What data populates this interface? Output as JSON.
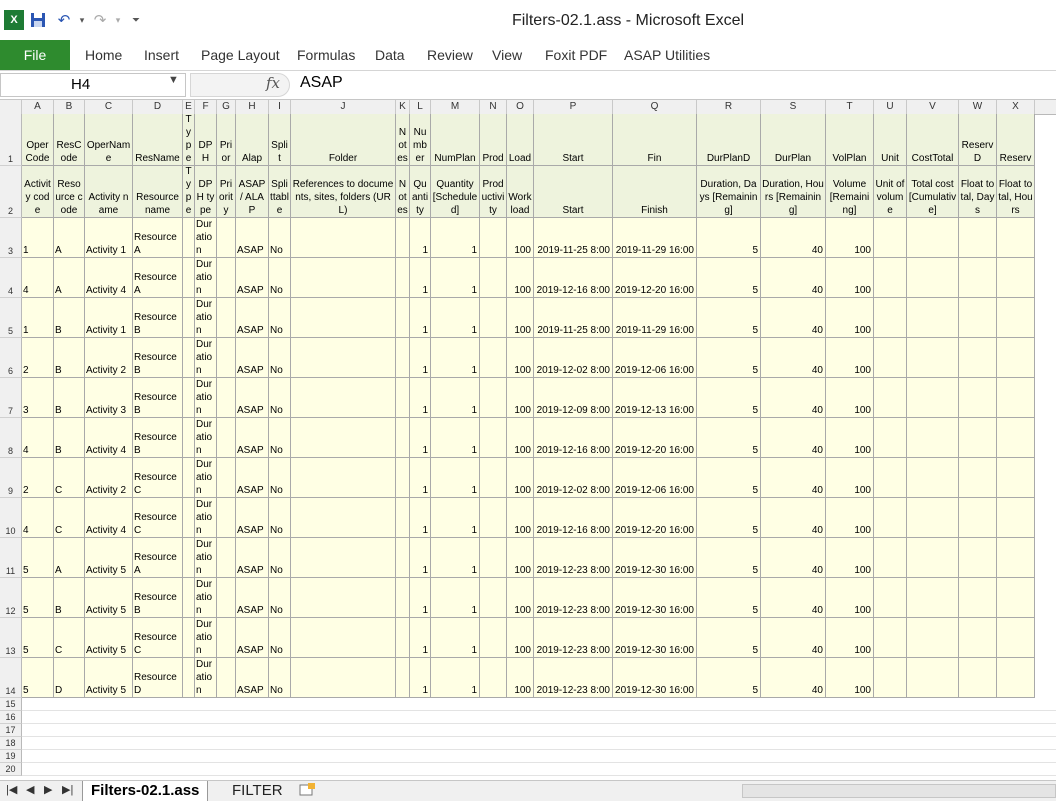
{
  "window": {
    "title": "Filters-02.1.ass  -  Microsoft Excel"
  },
  "ribbon": {
    "file": "File",
    "tabs": [
      "Home",
      "Insert",
      "Page Layout",
      "Formulas",
      "Data",
      "Review",
      "View",
      "Foxit PDF",
      "ASAP Utilities"
    ]
  },
  "formula_bar": {
    "name_box": "H4",
    "fx_label": "fx",
    "value": "ASAP"
  },
  "columns": [
    "A",
    "B",
    "C",
    "D",
    "E",
    "F",
    "G",
    "H",
    "I",
    "J",
    "K",
    "L",
    "M",
    "N",
    "O",
    "P",
    "Q",
    "R",
    "S",
    "T",
    "U",
    "V",
    "W",
    "X"
  ],
  "header_row1": [
    "Oper Code",
    "ResCode",
    "OperName",
    "ResName",
    "Type",
    "DPH",
    "Prior",
    "Alap",
    "Split",
    "Folder",
    "Notes",
    "Number",
    "NumPlan",
    "Prod",
    "Load",
    "Start",
    "Fin",
    "DurPlanD",
    "DurPlan",
    "VolPlan",
    "Unit",
    "CostTotal",
    "ReservD",
    "Reserv"
  ],
  "header_row2": [
    "Activity code",
    "Resource code",
    "Activity name",
    "Resource name",
    "Type",
    "DPH type",
    "Priority",
    "ASAP / ALAP",
    "Splittable",
    "References to documents, sites, folders (URL)",
    "Notes",
    "Quantity",
    "Quantity [Scheduled]",
    "Productivity",
    "Workload",
    "Start",
    "Finish",
    "Duration, Days [Remaining]",
    "Duration, Hours [Remaining]",
    "Volume [Remaining]",
    "Unit of volume",
    "Total cost [Cumulative]",
    "Float total, Days",
    "Float total, Hours"
  ],
  "rows": [
    {
      "n": "3",
      "a": "1",
      "b": "A",
      "c": "Activity 1",
      "d": "Resource A",
      "f": "Duration",
      "h": "ASAP",
      "i": "No",
      "l": "1",
      "m": "1",
      "o": "100",
      "p": "2019-11-25 8:00",
      "q": "2019-11-29 16:00",
      "r": "5",
      "s": "40",
      "t": "100"
    },
    {
      "n": "4",
      "a": "4",
      "b": "A",
      "c": "Activity 4",
      "d": "Resource A",
      "f": "Duration",
      "h": "ASAP",
      "i": "No",
      "l": "1",
      "m": "1",
      "o": "100",
      "p": "2019-12-16 8:00",
      "q": "2019-12-20 16:00",
      "r": "5",
      "s": "40",
      "t": "100"
    },
    {
      "n": "5",
      "a": "1",
      "b": "B",
      "c": "Activity 1",
      "d": "Resource B",
      "f": "Duration",
      "h": "ASAP",
      "i": "No",
      "l": "1",
      "m": "1",
      "o": "100",
      "p": "2019-11-25 8:00",
      "q": "2019-11-29 16:00",
      "r": "5",
      "s": "40",
      "t": "100"
    },
    {
      "n": "6",
      "a": "2",
      "b": "B",
      "c": "Activity 2",
      "d": "Resource B",
      "f": "Duration",
      "h": "ASAP",
      "i": "No",
      "l": "1",
      "m": "1",
      "o": "100",
      "p": "2019-12-02 8:00",
      "q": "2019-12-06 16:00",
      "r": "5",
      "s": "40",
      "t": "100"
    },
    {
      "n": "7",
      "a": "3",
      "b": "B",
      "c": "Activity 3",
      "d": "Resource B",
      "f": "Duration",
      "h": "ASAP",
      "i": "No",
      "l": "1",
      "m": "1",
      "o": "100",
      "p": "2019-12-09 8:00",
      "q": "2019-12-13 16:00",
      "r": "5",
      "s": "40",
      "t": "100"
    },
    {
      "n": "8",
      "a": "4",
      "b": "B",
      "c": "Activity 4",
      "d": "Resource B",
      "f": "Duration",
      "h": "ASAP",
      "i": "No",
      "l": "1",
      "m": "1",
      "o": "100",
      "p": "2019-12-16 8:00",
      "q": "2019-12-20 16:00",
      "r": "5",
      "s": "40",
      "t": "100"
    },
    {
      "n": "9",
      "a": "2",
      "b": "C",
      "c": "Activity 2",
      "d": "Resource C",
      "f": "Duration",
      "h": "ASAP",
      "i": "No",
      "l": "1",
      "m": "1",
      "o": "100",
      "p": "2019-12-02 8:00",
      "q": "2019-12-06 16:00",
      "r": "5",
      "s": "40",
      "t": "100"
    },
    {
      "n": "10",
      "a": "4",
      "b": "C",
      "c": "Activity 4",
      "d": "Resource C",
      "f": "Duration",
      "h": "ASAP",
      "i": "No",
      "l": "1",
      "m": "1",
      "o": "100",
      "p": "2019-12-16 8:00",
      "q": "2019-12-20 16:00",
      "r": "5",
      "s": "40",
      "t": "100"
    },
    {
      "n": "11",
      "a": "5",
      "b": "A",
      "c": "Activity 5",
      "d": "Resource A",
      "f": "Duration",
      "h": "ASAP",
      "i": "No",
      "l": "1",
      "m": "1",
      "o": "100",
      "p": "2019-12-23 8:00",
      "q": "2019-12-30 16:00",
      "r": "5",
      "s": "40",
      "t": "100"
    },
    {
      "n": "12",
      "a": "5",
      "b": "B",
      "c": "Activity 5",
      "d": "Resource B",
      "f": "Duration",
      "h": "ASAP",
      "i": "No",
      "l": "1",
      "m": "1",
      "o": "100",
      "p": "2019-12-23 8:00",
      "q": "2019-12-30 16:00",
      "r": "5",
      "s": "40",
      "t": "100"
    },
    {
      "n": "13",
      "a": "5",
      "b": "C",
      "c": "Activity 5",
      "d": "Resource C",
      "f": "Duration",
      "h": "ASAP",
      "i": "No",
      "l": "1",
      "m": "1",
      "o": "100",
      "p": "2019-12-23 8:00",
      "q": "2019-12-30 16:00",
      "r": "5",
      "s": "40",
      "t": "100"
    },
    {
      "n": "14",
      "a": "5",
      "b": "D",
      "c": "Activity 5",
      "d": "Resource D",
      "f": "Duration",
      "h": "ASAP",
      "i": "No",
      "l": "1",
      "m": "1",
      "o": "100",
      "p": "2019-12-23 8:00",
      "q": "2019-12-30 16:00",
      "r": "5",
      "s": "40",
      "t": "100"
    }
  ],
  "empty_rows": [
    "15",
    "16",
    "17",
    "18",
    "19",
    "20"
  ],
  "header_row_numbers": [
    "1",
    "2"
  ],
  "sheet_tabs": {
    "active": "Filters-02.1.ass",
    "other": "FILTER"
  },
  "icons": {
    "excel": "excel-logo-icon",
    "save": "save-icon",
    "undo": "undo-icon",
    "redo": "redo-icon",
    "fx": "function-icon"
  },
  "colors": {
    "file_tab": "#2e8b2e",
    "header_fill": "#eef3dd",
    "data_fill": "#ffffe4"
  }
}
